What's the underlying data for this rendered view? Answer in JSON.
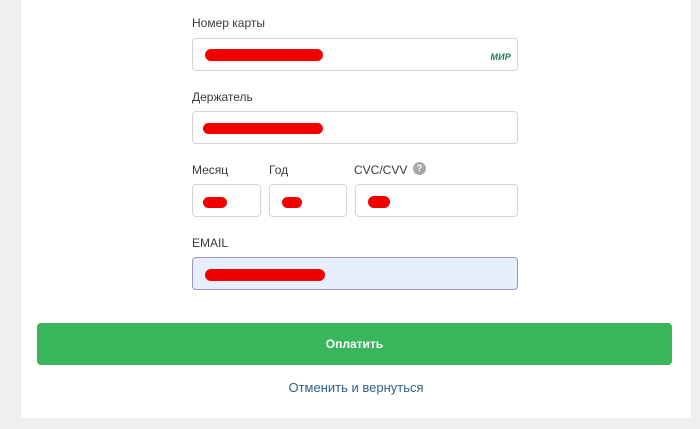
{
  "form": {
    "card_number_label": "Номер карты",
    "card_brand": "МИР",
    "holder_label": "Держатель",
    "month_label": "Месяц",
    "year_label": "Год",
    "cvc_label": "CVC/CVV",
    "cvc_help_symbol": "?",
    "email_label": "EMAIL"
  },
  "actions": {
    "pay_label": "Оплатить",
    "cancel_label": "Отменить и вернуться"
  },
  "colors": {
    "pay_button": "#3ab55b",
    "active_field_bg": "#e8effc",
    "redaction": "#f20000",
    "link": "#2f5f8a"
  }
}
